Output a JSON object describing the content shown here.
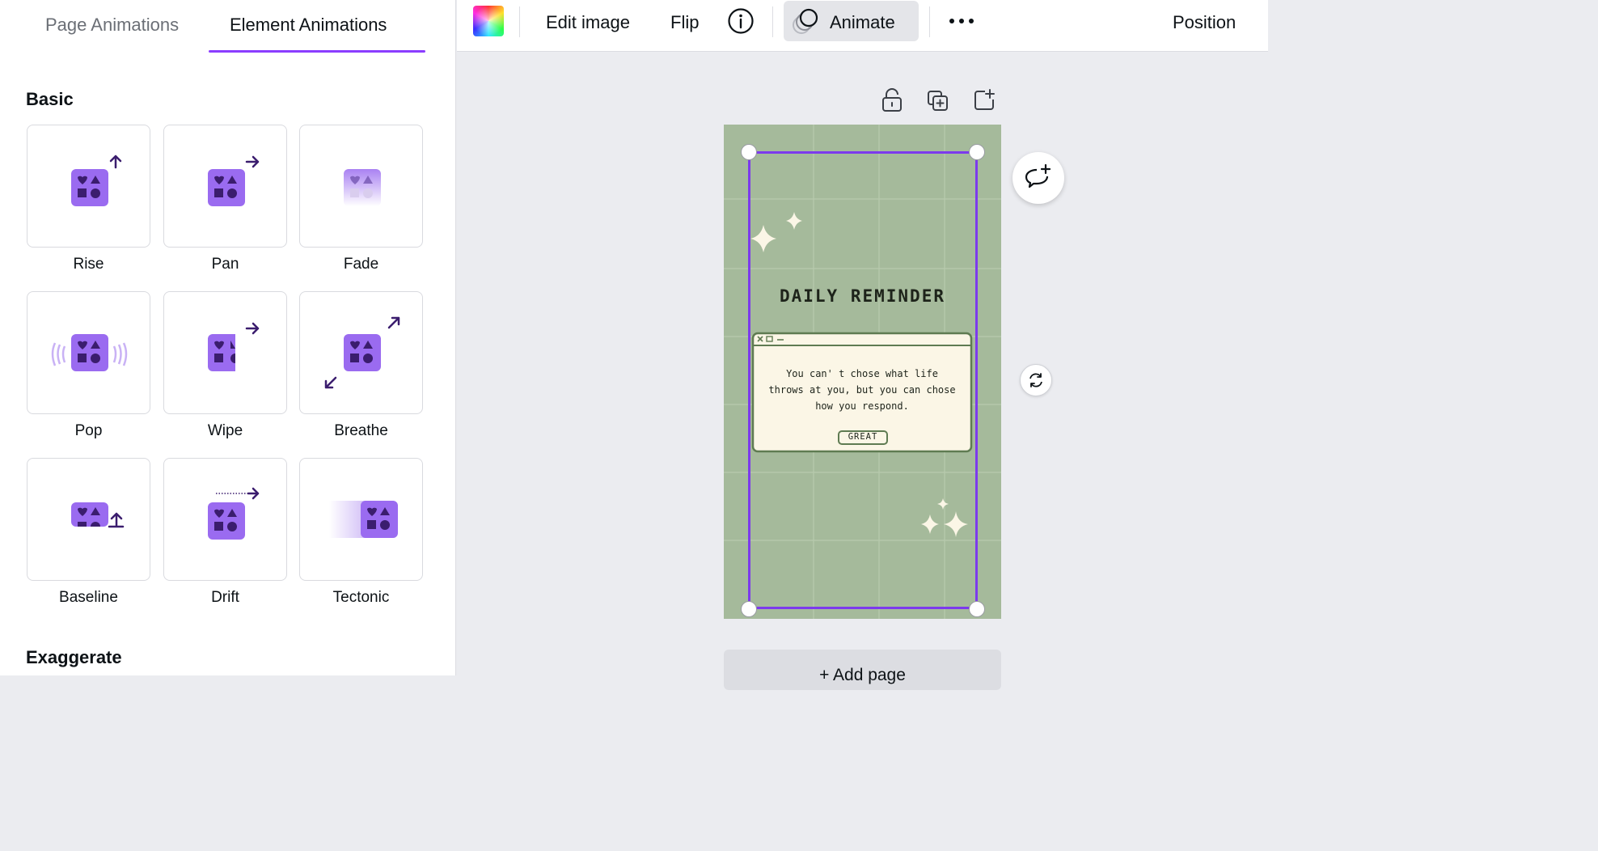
{
  "panel": {
    "tabs": [
      "Page Animations",
      "Element Animations"
    ],
    "active_tab": "Element Animations",
    "section_basic": "Basic",
    "section_exaggerate": "Exaggerate",
    "animations": [
      {
        "label": "Rise",
        "icon": "rise-icon"
      },
      {
        "label": "Pan",
        "icon": "pan-icon"
      },
      {
        "label": "Fade",
        "icon": "fade-icon"
      },
      {
        "label": "Pop",
        "icon": "pop-icon"
      },
      {
        "label": "Wipe",
        "icon": "wipe-icon"
      },
      {
        "label": "Breathe",
        "icon": "breathe-icon"
      },
      {
        "label": "Baseline",
        "icon": "baseline-icon"
      },
      {
        "label": "Drift",
        "icon": "drift-icon"
      },
      {
        "label": "Tectonic",
        "icon": "tectonic-icon"
      }
    ]
  },
  "toolbar": {
    "edit_image": "Edit image",
    "flip": "Flip",
    "info_icon": "info-icon",
    "animate": "Animate",
    "more_icon": "more-icon",
    "position": "Position"
  },
  "canvas": {
    "design": {
      "title": "DAILY REMINDER",
      "quote": [
        "You can' t chose what life",
        "throws at you, but you can chose",
        "how you respond."
      ],
      "button": "GREAT"
    },
    "add_page": "+ Add page"
  },
  "colors": {
    "accent": "#8b3dff",
    "icon_purple": "#9a6bf0",
    "icon_dark": "#3b1d6e",
    "page_green": "#a5ba9b",
    "selection": "#7c3aed"
  }
}
